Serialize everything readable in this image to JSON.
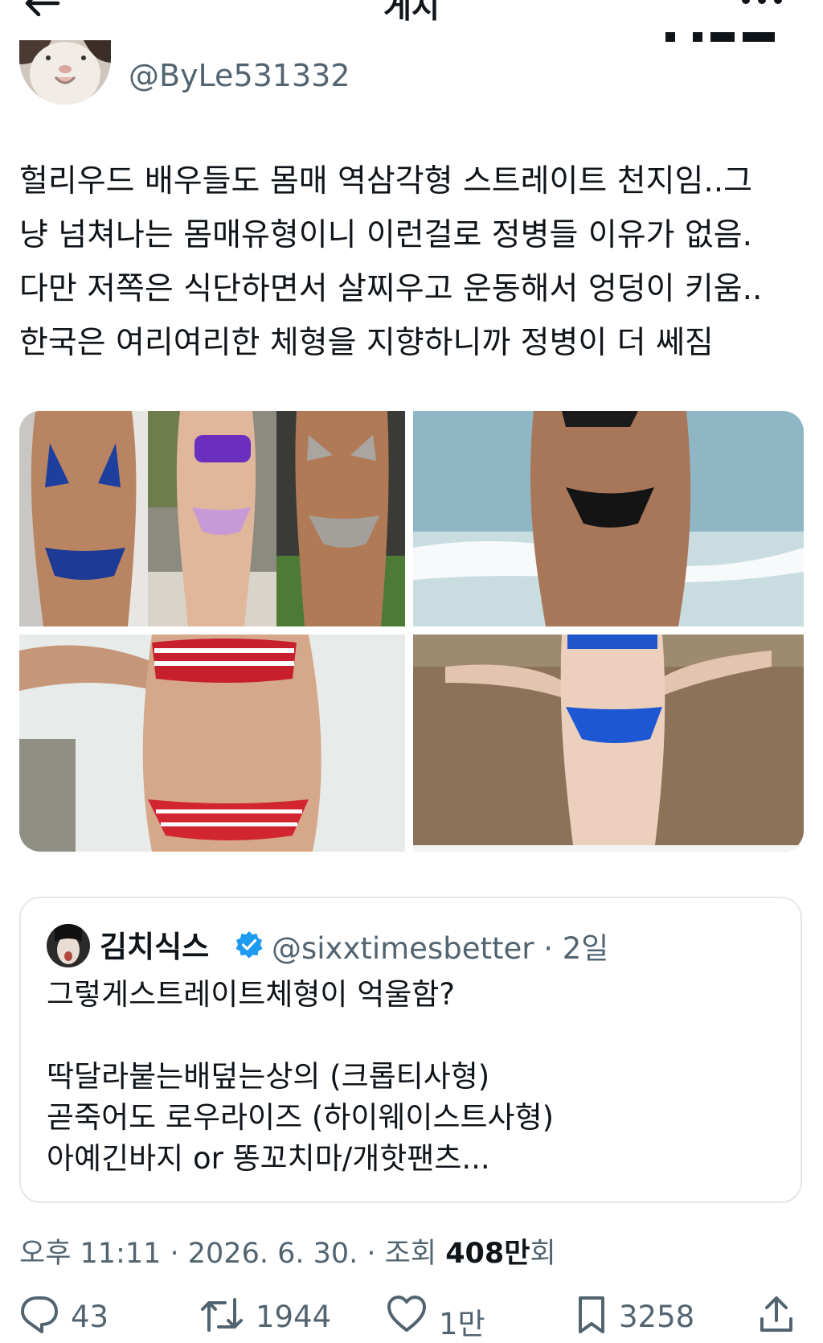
{
  "header": {
    "title": "게시",
    "back_icon": "arrow-left-icon",
    "more_icon": "more-icon"
  },
  "author": {
    "handle": "@ByLe531332"
  },
  "tweet": {
    "text": "헐리우드 배우들도 몸매 역삼각형 스트레이트 천지임..그\n냥 넘쳐나는 몸매유형이니 이런걸로 정병들 이유가 없음.\n다만 저쪽은 식단하면서 살찌우고 운동해서 엉덩이 키움..\n한국은 여리여리한 체형을 지향하니까 정병이 더 쎄짐"
  },
  "quote": {
    "name": "김치식스",
    "handle_time": "@sixxtimesbetter · 2일",
    "text": "그렇게스트레이트체형이 억울함?\n\n딱달라붙는배덮는상의 (크롭티사형)\n곧죽어도 로우라이즈 (하이웨이스트사형)\n아예긴바지 or 똥꼬치마/개핫팬츠..."
  },
  "meta": {
    "time_date": "오후 11:11 · 2026. 6. 30. · 조회 ",
    "views": "408만",
    "views_suffix": "회"
  },
  "actions": {
    "reply_count": "43",
    "retweet_count": "1944",
    "like_count": "1만",
    "bookmark_count": "3258"
  },
  "colors": {
    "secondary_text": "#536471",
    "primary_text": "#0f1419",
    "verified_blue": "#1d9bf0",
    "border": "#e3e7ea"
  }
}
